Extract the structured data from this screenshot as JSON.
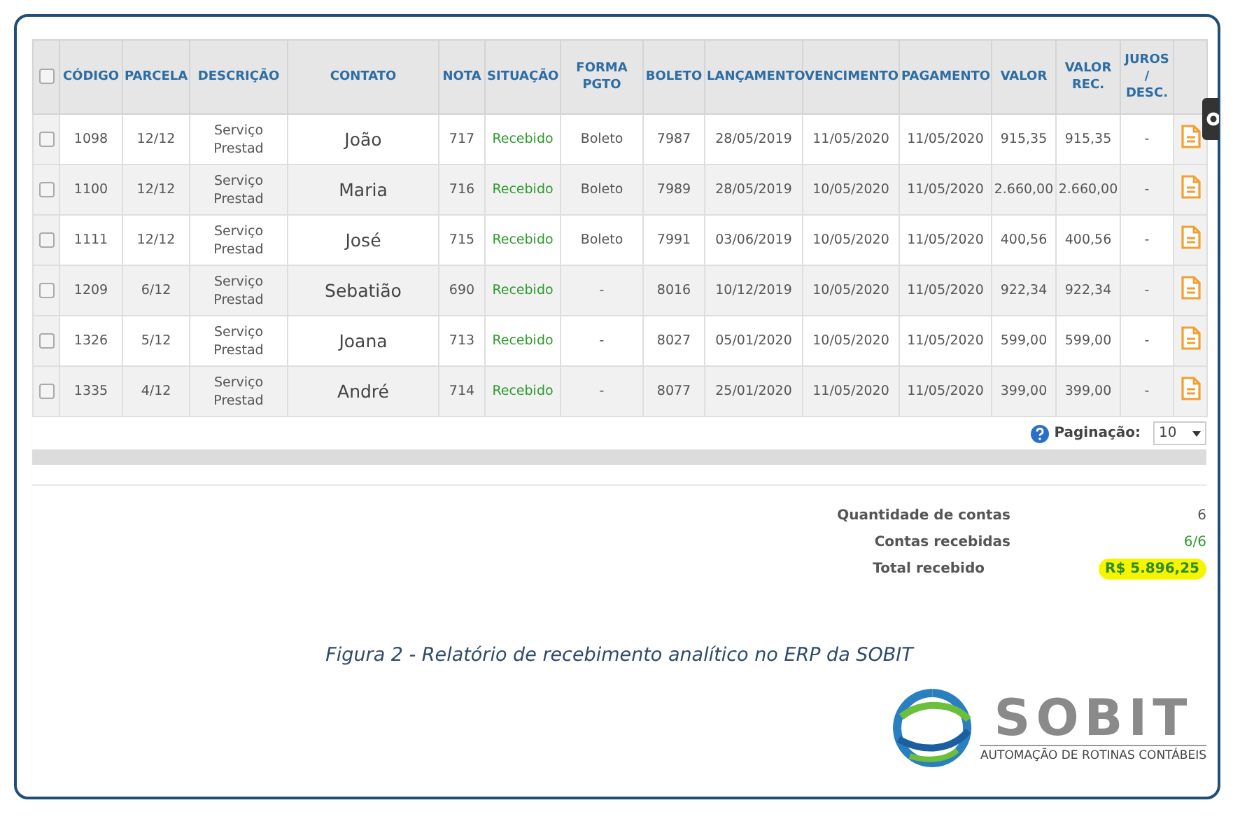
{
  "table": {
    "select_all": {
      "checked": false
    },
    "columns": [
      "CÓDIGO",
      "PARCELA",
      "DESCRIÇÃO",
      "CONTATO",
      "NOTA",
      "SITUAÇÃO",
      "FORMA PGTO",
      "BOLETO",
      "LANÇAMENTO",
      "VENCIMENTO",
      "PAGAMENTO",
      "VALOR",
      "VALOR REC.",
      "JUROS / DESC."
    ],
    "rows": [
      {
        "checked": false,
        "cells": [
          "1098",
          "12/12",
          "Serviço Prestad",
          "João",
          "717",
          "Recebido",
          "Boleto",
          "7987",
          "28/05/2019",
          "11/05/2020",
          "11/05/2020",
          "915,35",
          "915,35",
          "-"
        ]
      },
      {
        "checked": false,
        "cells": [
          "1100",
          "12/12",
          "Serviço Prestad",
          "Maria",
          "716",
          "Recebido",
          "Boleto",
          "7989",
          "28/05/2019",
          "10/05/2020",
          "11/05/2020",
          "2.660,00",
          "2.660,00",
          "-"
        ]
      },
      {
        "checked": false,
        "cells": [
          "1111",
          "12/12",
          "Serviço Prestad",
          "José",
          "715",
          "Recebido",
          "Boleto",
          "7991",
          "03/06/2019",
          "10/05/2020",
          "11/05/2020",
          "400,56",
          "400,56",
          "-"
        ]
      },
      {
        "checked": false,
        "cells": [
          "1209",
          "6/12",
          "Serviço Prestad",
          "Sebatião",
          "690",
          "Recebido",
          "-",
          "8016",
          "10/12/2019",
          "10/05/2020",
          "11/05/2020",
          "922,34",
          "922,34",
          "-"
        ]
      },
      {
        "checked": false,
        "cells": [
          "1326",
          "5/12",
          "Serviço Prestad",
          "Joana",
          "713",
          "Recebido",
          "-",
          "8027",
          "05/01/2020",
          "10/05/2020",
          "11/05/2020",
          "599,00",
          "599,00",
          "-"
        ]
      },
      {
        "checked": false,
        "cells": [
          "1335",
          "4/12",
          "Serviço Prestad",
          "André",
          "714",
          "Recebido",
          "-",
          "8077",
          "25/01/2020",
          "11/05/2020",
          "11/05/2020",
          "399,00",
          "399,00",
          "-"
        ]
      }
    ]
  },
  "pagination": {
    "label": "Paginação:",
    "value": "10"
  },
  "summary": [
    {
      "label": "Quantidade de contas",
      "value": "6",
      "kind": "plain"
    },
    {
      "label": "Contas recebidas",
      "value": "6/6",
      "kind": "success"
    },
    {
      "label": "Total recebido",
      "value": "R$ 5.896,25",
      "kind": "highlight"
    }
  ],
  "caption": "Figura 2 - Relatório de recebimento analítico no ERP da SOBIT",
  "logo": {
    "name": "SOBIT",
    "tagline": "AUTOMAÇÃO DE ROTINAS CONTÁBEIS"
  }
}
